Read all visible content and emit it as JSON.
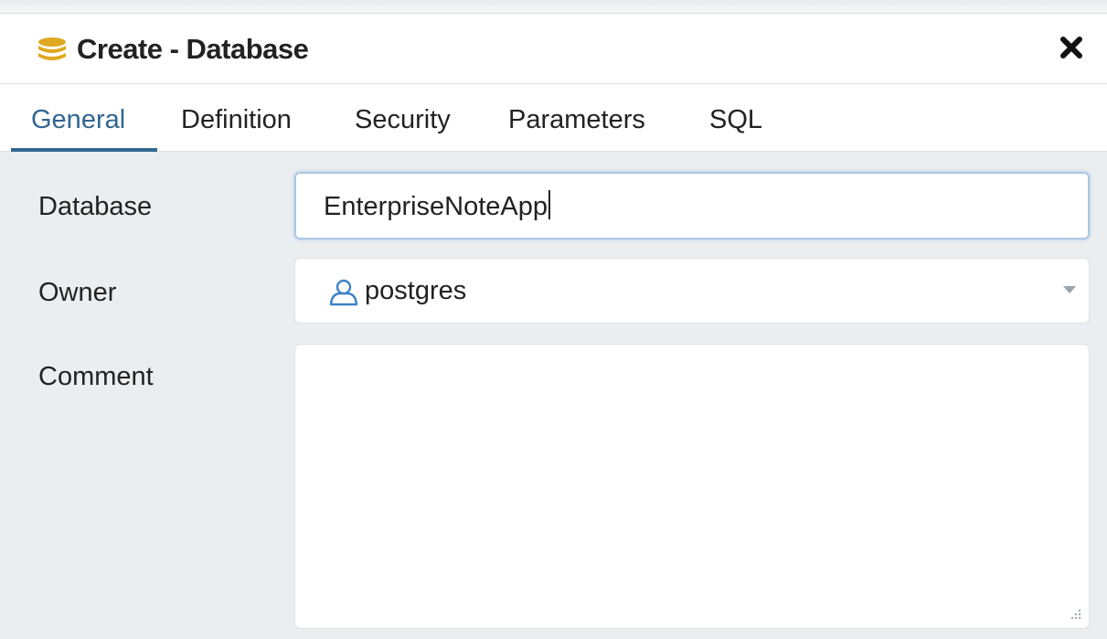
{
  "dialog": {
    "title": "Create - Database",
    "title_icon": "database-icon",
    "close_icon": "close-icon"
  },
  "tabs": [
    {
      "label": "General",
      "active": true
    },
    {
      "label": "Definition",
      "active": false
    },
    {
      "label": "Security",
      "active": false
    },
    {
      "label": "Parameters",
      "active": false
    },
    {
      "label": "SQL",
      "active": false
    }
  ],
  "form": {
    "database": {
      "label": "Database",
      "value": "EnterpriseNoteApp"
    },
    "owner": {
      "label": "Owner",
      "value": "postgres",
      "icon": "user-icon"
    },
    "comment": {
      "label": "Comment",
      "value": ""
    }
  },
  "colors": {
    "accent": "#326690",
    "title_icon": "#e0a820",
    "user_icon": "#3b82c4",
    "panel_background": "#ebeef1",
    "focus_border": "#a9c6e4"
  }
}
